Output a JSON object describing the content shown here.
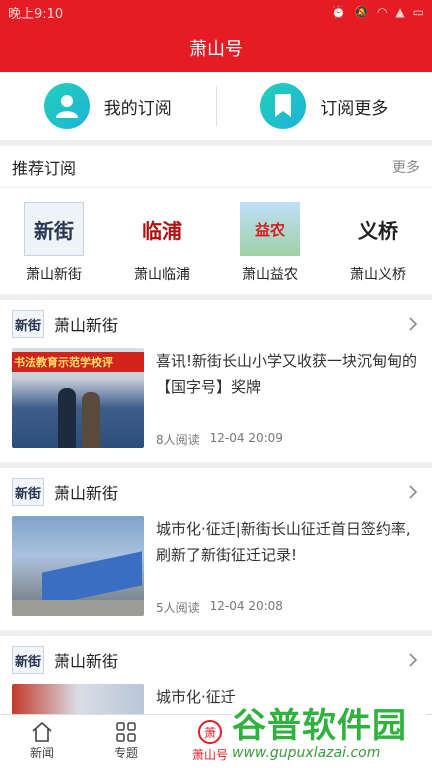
{
  "status_bar": {
    "time": "晚上9:10"
  },
  "header": {
    "title": "萧山号"
  },
  "subscribe": {
    "mine_label": "我的订阅",
    "more_label": "订阅更多"
  },
  "recommend": {
    "title": "推荐订阅",
    "more": "更多",
    "items": [
      {
        "name": "萧山新街",
        "logo_text": "新街"
      },
      {
        "name": "萧山临浦",
        "logo_text": "临浦"
      },
      {
        "name": "萧山益农",
        "logo_text": "益农"
      },
      {
        "name": "萧山义桥",
        "logo_text": "义桥"
      }
    ]
  },
  "feed": [
    {
      "source": "萧山新街",
      "logo_text": "新街",
      "title": "喜讯!新街长山小学又收获一块沉甸甸的【国字号】奖牌",
      "reads": "8人阅读",
      "time": "12-04 20:09",
      "banner": "书法教育示范学校评"
    },
    {
      "source": "萧山新街",
      "logo_text": "新街",
      "title": "城市化·征迁|新街长山征迁首日签约率,刷新了新街征迁记录!",
      "reads": "5人阅读",
      "time": "12-04 20:08"
    },
    {
      "source": "萧山新街",
      "logo_text": "新街",
      "title": "城市化·征迁"
    }
  ],
  "bottom_nav": [
    {
      "label": "新闻",
      "icon": "home-icon"
    },
    {
      "label": "专题",
      "icon": "grid-icon"
    },
    {
      "label": "萧山号",
      "icon": "xiaoshan-circle-icon",
      "badge": "萧"
    },
    {
      "label": "",
      "icon": ""
    }
  ],
  "watermark": {
    "main": "谷普软件园",
    "url": "www.gupuxlazai.com"
  },
  "colors": {
    "brand_red": "#e51c23",
    "teal": "#1ec3c6"
  }
}
